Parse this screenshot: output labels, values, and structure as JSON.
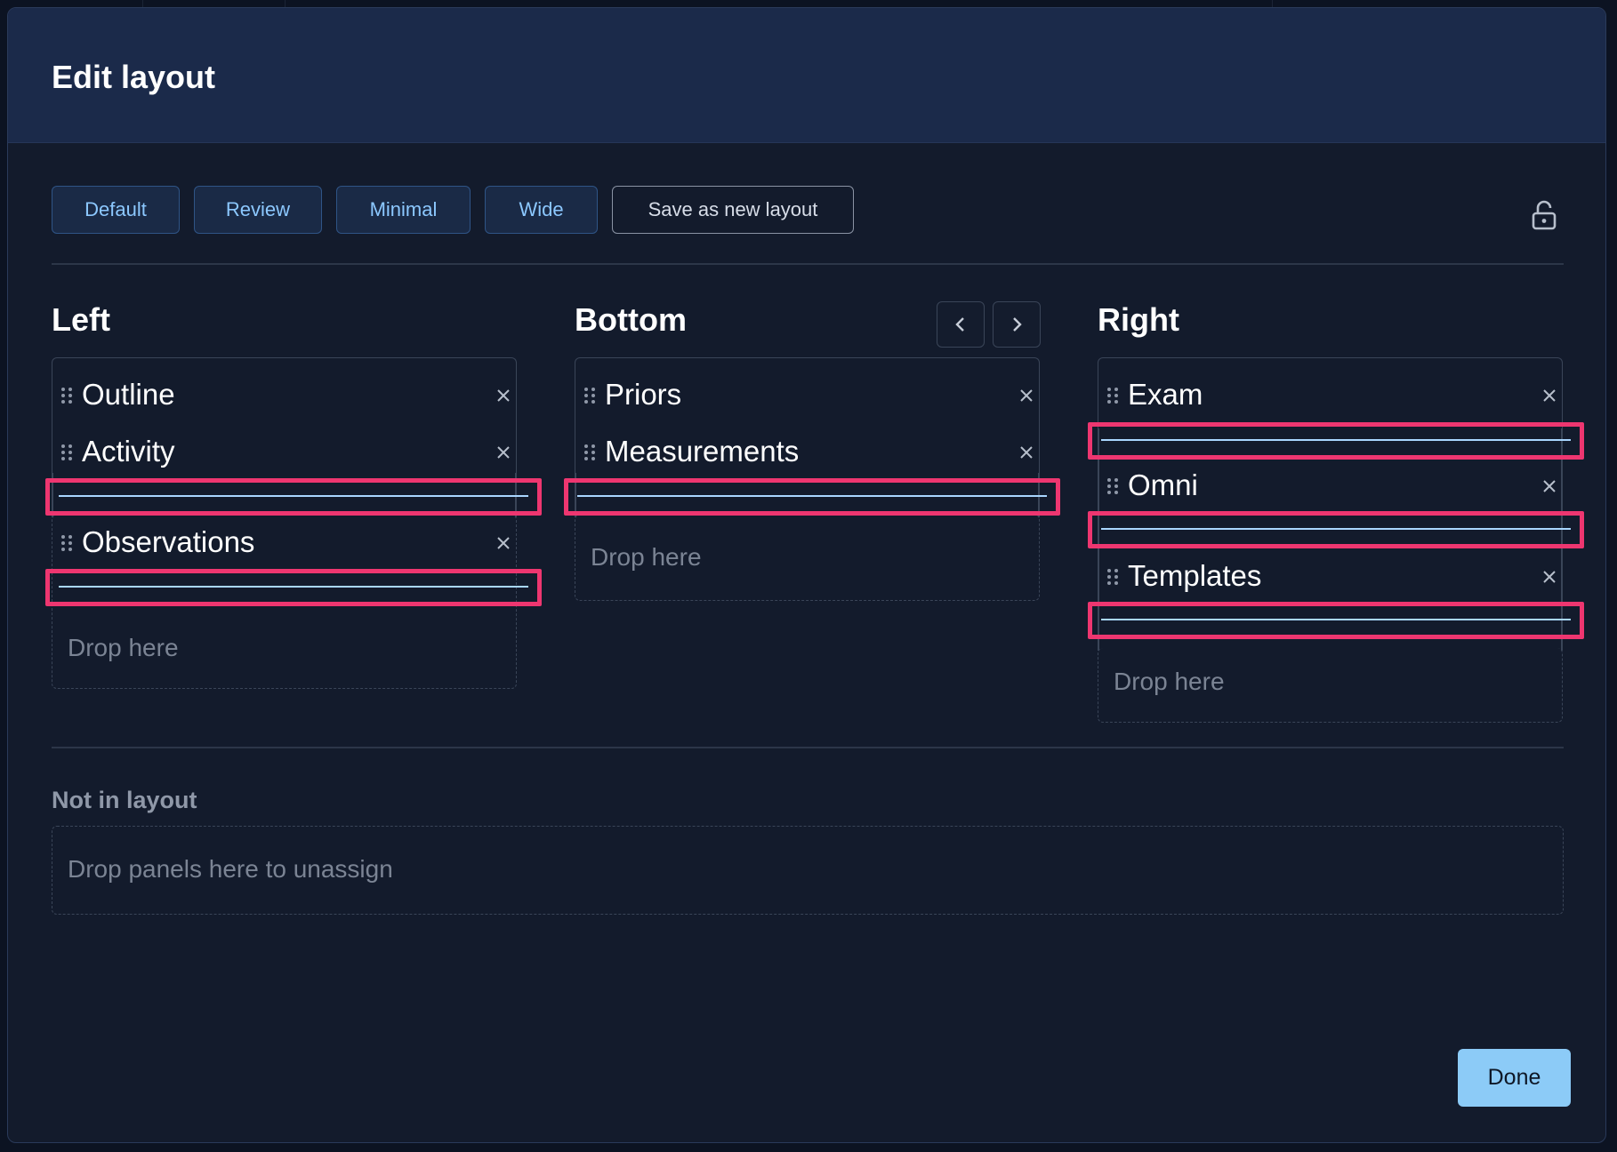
{
  "modal": {
    "title": "Edit layout"
  },
  "toolbar": {
    "presets": [
      "Default",
      "Review",
      "Minimal",
      "Wide"
    ],
    "save_label": "Save as new layout"
  },
  "columns": {
    "left": {
      "title": "Left",
      "panels": [
        "Outline",
        "Activity",
        "Observations"
      ],
      "drop_text": "Drop here"
    },
    "bottom": {
      "title": "Bottom",
      "panels": [
        "Priors",
        "Measurements"
      ],
      "drop_text": "Drop here"
    },
    "right": {
      "title": "Right",
      "panels": [
        "Exam",
        "Omni",
        "Templates"
      ],
      "drop_text": "Drop here"
    }
  },
  "unassigned": {
    "title": "Not in layout",
    "drop_text": "Drop panels here to unassign"
  },
  "footer": {
    "done_label": "Done"
  },
  "colors": {
    "accent": "#8cc8ff",
    "drop_highlight": "#ee3670",
    "done_bg": "#8ccbf7"
  }
}
